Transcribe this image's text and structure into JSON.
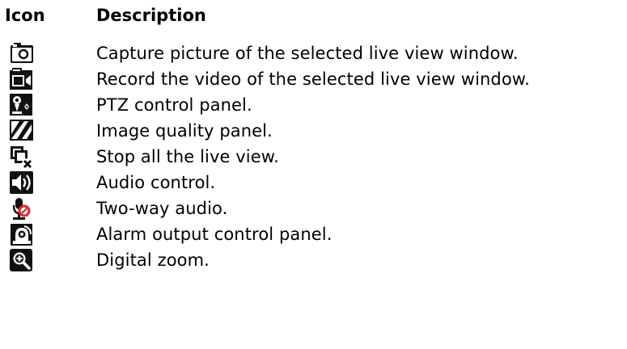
{
  "header": {
    "icon_label": "Icon",
    "description_label": "Description"
  },
  "rows": [
    {
      "icon": "camera-icon",
      "description": "Capture picture of the selected live view window."
    },
    {
      "icon": "video-record-icon",
      "description": "Record the video of the selected live view window."
    },
    {
      "icon": "ptz-control-icon",
      "description": "PTZ control panel."
    },
    {
      "icon": "image-quality-icon",
      "description": "Image quality panel."
    },
    {
      "icon": "stop-live-view-icon",
      "description": "Stop all the live view."
    },
    {
      "icon": "speaker-icon",
      "description": "Audio control."
    },
    {
      "icon": "two-way-audio-icon",
      "description": "Two-way audio."
    },
    {
      "icon": "alarm-output-icon",
      "description": "Alarm output control panel."
    },
    {
      "icon": "digital-zoom-icon",
      "description": "Digital zoom."
    }
  ],
  "colors": {
    "icon_dark": "#111111",
    "icon_red": "#e0262b",
    "text": "#000000"
  }
}
